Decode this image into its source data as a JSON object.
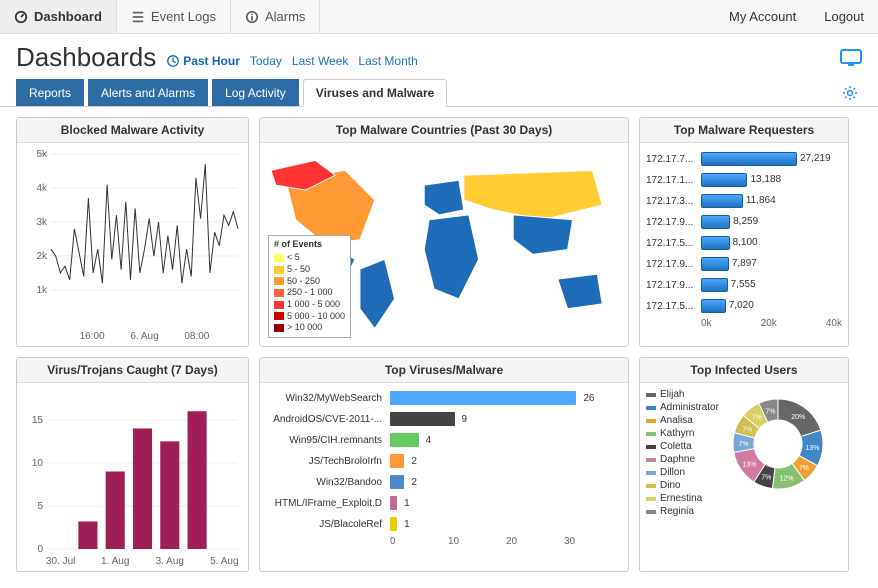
{
  "topnav": {
    "dashboard": "Dashboard",
    "event_logs": "Event Logs",
    "alarms": "Alarms",
    "my_account": "My Account",
    "logout": "Logout"
  },
  "page_title": "Dashboards",
  "time_filters": {
    "past_hour": "Past Hour",
    "today": "Today",
    "last_week": "Last Week",
    "last_month": "Last Month"
  },
  "tabs": {
    "reports": "Reports",
    "alerts": "Alerts and Alarms",
    "log_activity": "Log Activity",
    "viruses": "Viruses and Malware"
  },
  "panels": {
    "blocked_activity": "Blocked Malware Activity",
    "top_countries": "Top Malware Countries (Past 30 Days)",
    "top_requesters": "Top Malware Requesters",
    "virus_caught": "Virus/Trojans Caught (7 Days)",
    "top_viruses": "Top Viruses/Malware",
    "top_infected": "Top Infected Users"
  },
  "map_legend": {
    "title": "# of Events",
    "ranges": [
      {
        "label": "< 5",
        "color": "#ffff66"
      },
      {
        "label": "5 - 50",
        "color": "#ffcc33"
      },
      {
        "label": "50 - 250",
        "color": "#ff9933"
      },
      {
        "label": "250 - 1 000",
        "color": "#ff6633"
      },
      {
        "label": "1 000 - 5 000",
        "color": "#ff3333"
      },
      {
        "label": "5 000 - 10 000",
        "color": "#cc0000"
      },
      {
        "label": "> 10 000",
        "color": "#990000"
      }
    ]
  },
  "chart_data": [
    {
      "id": "blocked_activity",
      "type": "line",
      "title": "Blocked Malware Activity",
      "ylim": [
        0,
        5000
      ],
      "yticks": [
        "1k",
        "2k",
        "3k",
        "4k",
        "5k"
      ],
      "xticks": [
        "16:00",
        "6. Aug",
        "08:00"
      ],
      "series": [
        {
          "name": "events",
          "values": [
            2200,
            2000,
            1500,
            1700,
            1300,
            2800,
            2100,
            1400,
            3700,
            1500,
            2200,
            1200,
            4100,
            1900,
            3200,
            1600,
            3600,
            1300,
            3400,
            1500,
            2200,
            3100,
            2000,
            3000,
            1500,
            2600,
            1600,
            2900,
            1200,
            2200,
            1400,
            4300,
            3100,
            4700,
            1500,
            2700,
            2300,
            3200,
            2900,
            3300,
            2800
          ]
        }
      ]
    },
    {
      "id": "top_requesters",
      "type": "bar",
      "orientation": "horizontal",
      "title": "Top Malware Requesters",
      "xlim": [
        0,
        40000
      ],
      "xticks": [
        "0k",
        "20k",
        "40k"
      ],
      "categories": [
        "172.17.7...",
        "172.17.1...",
        "172.17.3...",
        "172.17.9...",
        "172.17.5...",
        "172.17.9...",
        "172.17.9...",
        "172.17.5..."
      ],
      "values": [
        27219,
        13188,
        11864,
        8259,
        8100,
        7897,
        7555,
        7020
      ]
    },
    {
      "id": "virus_caught",
      "type": "bar",
      "title": "Virus/Trojans Caught (7 Days)",
      "ylim": [
        0,
        18
      ],
      "yticks": [
        0,
        5,
        10,
        15
      ],
      "categories": [
        "30. Jul",
        "1. Aug",
        "3. Aug",
        "5. Aug"
      ],
      "series": [
        {
          "name": "count",
          "values": [
            0,
            3.2,
            9,
            14,
            12.5,
            16,
            0
          ]
        }
      ],
      "bar_color": "#a01e58"
    },
    {
      "id": "top_viruses",
      "type": "bar",
      "orientation": "horizontal",
      "title": "Top Viruses/Malware",
      "xlim": [
        0,
        30
      ],
      "xticks": [
        0,
        10,
        20,
        30
      ],
      "categories": [
        "Win32/MyWebSearch",
        "AndroidOS/CVE-2011-...",
        "Win95/CIH.remnants",
        "JS/TechBroloIrfn",
        "Win32/Bandoo",
        "HTML/IFrame_Exploit.D",
        "JS/BlacoleRef"
      ],
      "values": [
        26,
        9,
        4,
        2,
        2,
        1,
        1
      ],
      "colors": [
        "#4da6ff",
        "#444444",
        "#66cc66",
        "#ff9933",
        "#4d88cc",
        "#cc6699",
        "#e6d000"
      ]
    },
    {
      "id": "top_infected",
      "type": "pie",
      "style": "donut",
      "title": "Top Infected Users",
      "categories": [
        "Elijah",
        "Administrator",
        "Analisa",
        "Kathyrn",
        "Coletta",
        "Daphne",
        "Dillon",
        "Dino",
        "Ernestina",
        "Reginia"
      ],
      "values": [
        20,
        13,
        7,
        12,
        7,
        13,
        7,
        7,
        7,
        7
      ],
      "colors": [
        "#666666",
        "#3f87c5",
        "#f0a030",
        "#88c070",
        "#444444",
        "#d17ba0",
        "#7aa8d6",
        "#cfc050",
        "#d8d060",
        "#888888"
      ]
    }
  ]
}
